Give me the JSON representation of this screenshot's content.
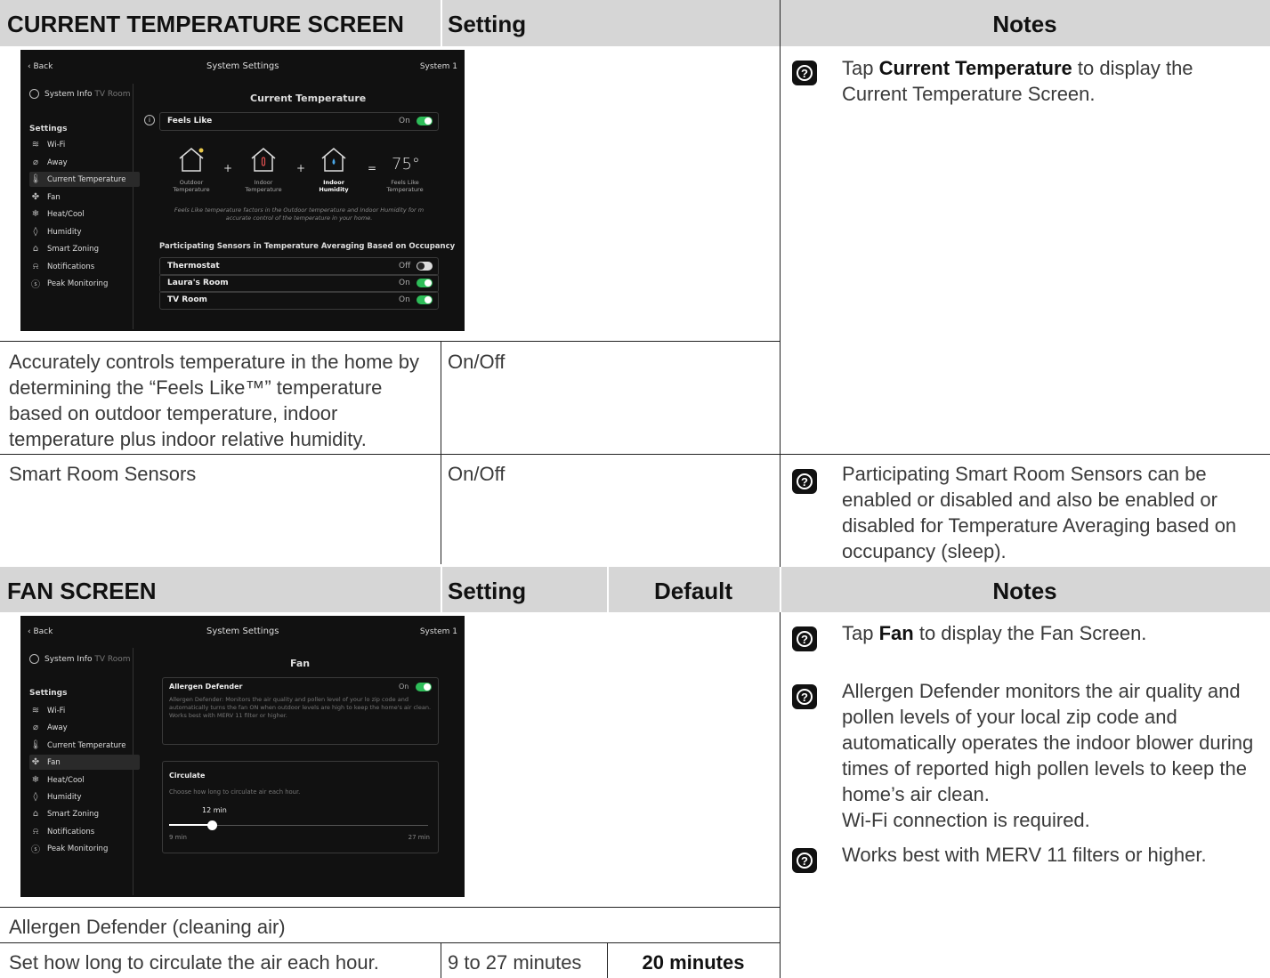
{
  "cts": {
    "title": "CURRENT TEMPERATURE SCREEN",
    "setting_hdr": "Setting",
    "notes_hdr": "Notes",
    "note1_pre": "Tap ",
    "note1_bold": "Current Temperature",
    "note1_post": " to display the Current Temperature Screen.",
    "row1_desc": "Accurately controls temperature in the home by determining the “Feels Like™” temperature based on outdoor temperature, indoor temperature plus indoor relative humidity.",
    "row1_setting": "On/Off",
    "row2_desc": "Smart Room Sensors",
    "row2_setting": "On/Off",
    "row2_note": "Participating Smart Room Sensors can be enabled or disabled and also be enabled or disabled for Temperature Averaging based on occupancy (sleep)."
  },
  "fan": {
    "title": "FAN SCREEN",
    "setting_hdr": "Setting",
    "default_hdr": "Default",
    "notes_hdr": "Notes",
    "note1_pre": "Tap ",
    "note1_bold": "Fan",
    "note1_post": " to display the Fan Screen.",
    "note2": "Allergen Defender monitors the air quality and pollen levels of your local zip code and automatically operates the indoor blower during times of reported high pollen levels to keep the home’s air clean.",
    "note2b": "Wi-Fi connection is required.",
    "note3": "Works best with MERV 11 filters or higher.",
    "row1_desc": "Allergen Defender (cleaning air)",
    "row2_desc": "Set how long to circulate the air each hour.",
    "row2_setting": "9 to 27 minutes",
    "row2_default": "20 minutes"
  },
  "screen": {
    "back": "Back",
    "header": "System Settings",
    "system": "System 1",
    "tab_info": "System Info",
    "tab_tv": "TV",
    "tab_room": "Room",
    "settings_label": "Settings",
    "menu": [
      "Wi-Fi",
      "Away",
      "Current Temperature",
      "Fan",
      "Heat/Cool",
      "Humidity",
      "Smart Zoning",
      "Notifications",
      "Peak Monitoring"
    ],
    "on": "On",
    "off": "Off"
  },
  "screen1": {
    "title": "Current Temperature",
    "feels_like": "Feels Like",
    "lbl_outdoor": "Outdoor Temperature",
    "lbl_indoor": "Indoor Temperature",
    "lbl_humidity": "Indoor Humidity",
    "lbl_feels": "Feels Like Temperature",
    "plus": "+",
    "equals": "=",
    "temp": "75°",
    "desc": "Feels Like temperature factors in the Outdoor temperature and Indoor Humidity for m accurate control of the temperature in your home.",
    "sensors_title": "Participating Sensors in Temperature Averaging Based on Occupancy",
    "sensors": [
      {
        "name": "Thermostat",
        "state": "Off"
      },
      {
        "name": "Laura's Room",
        "state": "On"
      },
      {
        "name": "TV Room",
        "state": "On"
      }
    ]
  },
  "screen2": {
    "title": "Fan",
    "allergen": "Allergen Defender",
    "allergen_desc": "Allergen Defender: Monitors the air quality and pollen level of your lo zip code and automatically turns the fan ON when outdoor levels are high to keep the home's air clean. Works best with MERV 11 filter or higher.",
    "circulate": "Circulate",
    "circulate_desc": "Choose how long to circulate air each hour.",
    "slider_value": "12 min",
    "slider_min": "9 min",
    "slider_max": "27 min",
    "slider_fraction": 0.167
  },
  "colors": {
    "toggle_on": "#2ebd59",
    "header_bg": "#d6d6d6"
  }
}
